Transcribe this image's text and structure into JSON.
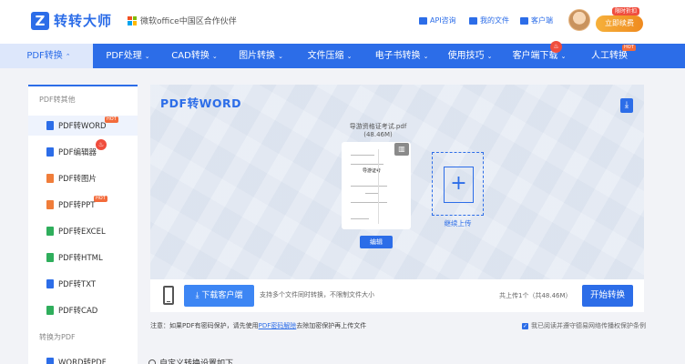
{
  "header": {
    "logo_letter": "Z",
    "logo_text": "转转大师",
    "partner_text": "微软office中国区合作伙伴",
    "links": [
      {
        "label": "API咨询",
        "icon": "chat-icon"
      },
      {
        "label": "我的文件",
        "icon": "folder-icon"
      },
      {
        "label": "客户端",
        "icon": "monitor-icon"
      }
    ],
    "limited_badge": "限时折扣",
    "renew_label": "立即续费"
  },
  "nav": {
    "items": [
      {
        "label": "PDF转换",
        "chevron": "⌃",
        "active": true
      },
      {
        "label": "PDF处理",
        "chevron": "⌄"
      },
      {
        "label": "CAD转换",
        "chevron": "⌄"
      },
      {
        "label": "图片转换",
        "chevron": "⌄"
      },
      {
        "label": "文件压缩",
        "chevron": "⌄"
      },
      {
        "label": "电子书转换",
        "chevron": "⌄"
      },
      {
        "label": "使用技巧",
        "chevron": "⌄"
      },
      {
        "label": "客户端下载",
        "chevron": "⌄"
      },
      {
        "label": "人工转换",
        "chevron": ""
      }
    ],
    "hot_tag": "HOT"
  },
  "sidebar": {
    "section1": "PDF转其他",
    "items1": [
      {
        "label": "PDF转WORD",
        "icon": "word-icon",
        "color": "#2c6de8",
        "badge": "HOT"
      },
      {
        "label": "PDF编辑器",
        "icon": "editor-icon",
        "color": "#2c6de8",
        "badge": ""
      },
      {
        "label": "PDF转图片",
        "icon": "image-icon",
        "color": "#f07d3a",
        "badge": ""
      },
      {
        "label": "PDF转PPT",
        "icon": "ppt-icon",
        "color": "#f07d3a",
        "badge": "HOT"
      },
      {
        "label": "PDF转EXCEL",
        "icon": "excel-icon",
        "color": "#2fae5c",
        "badge": ""
      },
      {
        "label": "PDF转HTML",
        "icon": "html-icon",
        "color": "#2fae5c",
        "badge": ""
      },
      {
        "label": "PDF转TXT",
        "icon": "txt-icon",
        "color": "#2c6de8",
        "badge": ""
      },
      {
        "label": "PDF转CAD",
        "icon": "cad-icon",
        "color": "#2fae5c",
        "badge": ""
      }
    ],
    "section2": "转换为PDF",
    "items2": [
      {
        "label": "WORD转PDF",
        "icon": "word-icon",
        "color": "#2c6de8"
      }
    ]
  },
  "main": {
    "title": "PDF转WORD",
    "file_name": "导游资格证考试.pdf",
    "file_size": "(48.46M)",
    "thumb_text": "导游证考",
    "edit_label": "编辑",
    "add_label": "继续上传",
    "add_symbol": "+"
  },
  "bottom": {
    "client_label": "⤓ 下载客户端",
    "hint": "支持多个文件同时转换，不限制文件大小",
    "count": "共上传1个（共48.46M）",
    "start_label": "开始转换"
  },
  "notice": {
    "prefix": "注意：如果PDF有密码保护，请先使用",
    "link": "PDF密码解除",
    "suffix": "去除加密保护再上传文件",
    "agree": "我已阅读并遵守德易网络传播权保护条例"
  },
  "custom_settings": "自定义转换设置如下"
}
